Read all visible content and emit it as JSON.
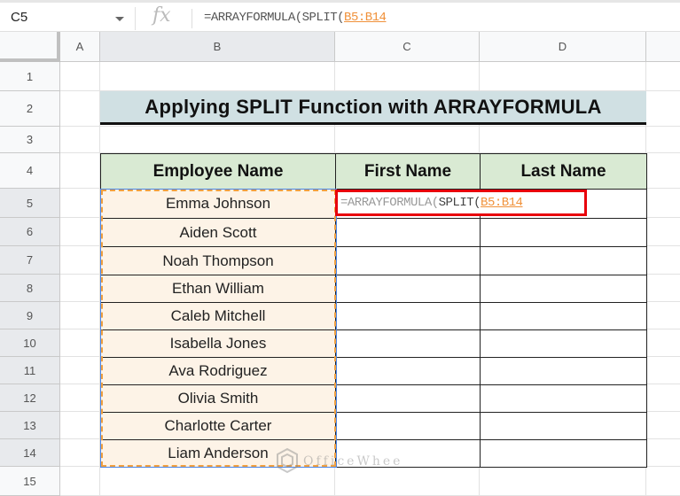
{
  "formula_bar": {
    "name_box": "C5",
    "fx_label": "fx",
    "formula_prefix": "=ARRAYFORMULA(",
    "formula_func": "SPLIT(",
    "formula_ref": "B5:B14"
  },
  "columns": [
    "A",
    "B",
    "C",
    "D"
  ],
  "rows": [
    "1",
    "2",
    "3",
    "4",
    "5",
    "6",
    "7",
    "8",
    "9",
    "10",
    "11",
    "12",
    "13",
    "14",
    "15"
  ],
  "title": "Applying SPLIT Function with ARRAYFORMULA",
  "table": {
    "headers": [
      "Employee Name",
      "First Name",
      "Last Name"
    ],
    "names": [
      "Emma Johnson",
      "Aiden Scott",
      "Noah Thompson",
      "Ethan William",
      "Caleb Mitchell",
      "Isabella Jones",
      "Ava Rodriguez",
      "Olivia Smith",
      "Charlotte Carter",
      "Liam Anderson"
    ]
  },
  "editor": {
    "prefix": "=ARRAYFORMULA(",
    "func": "SPLIT(",
    "ref": "B5:B14"
  },
  "watermark": "OfficeWheel",
  "colors": {
    "title_bg": "#d0e0e3",
    "header_bg": "#d9ead3",
    "name_bg": "#fdf3e7",
    "editor_border": "#e8000b",
    "ref": "#f0913a"
  }
}
